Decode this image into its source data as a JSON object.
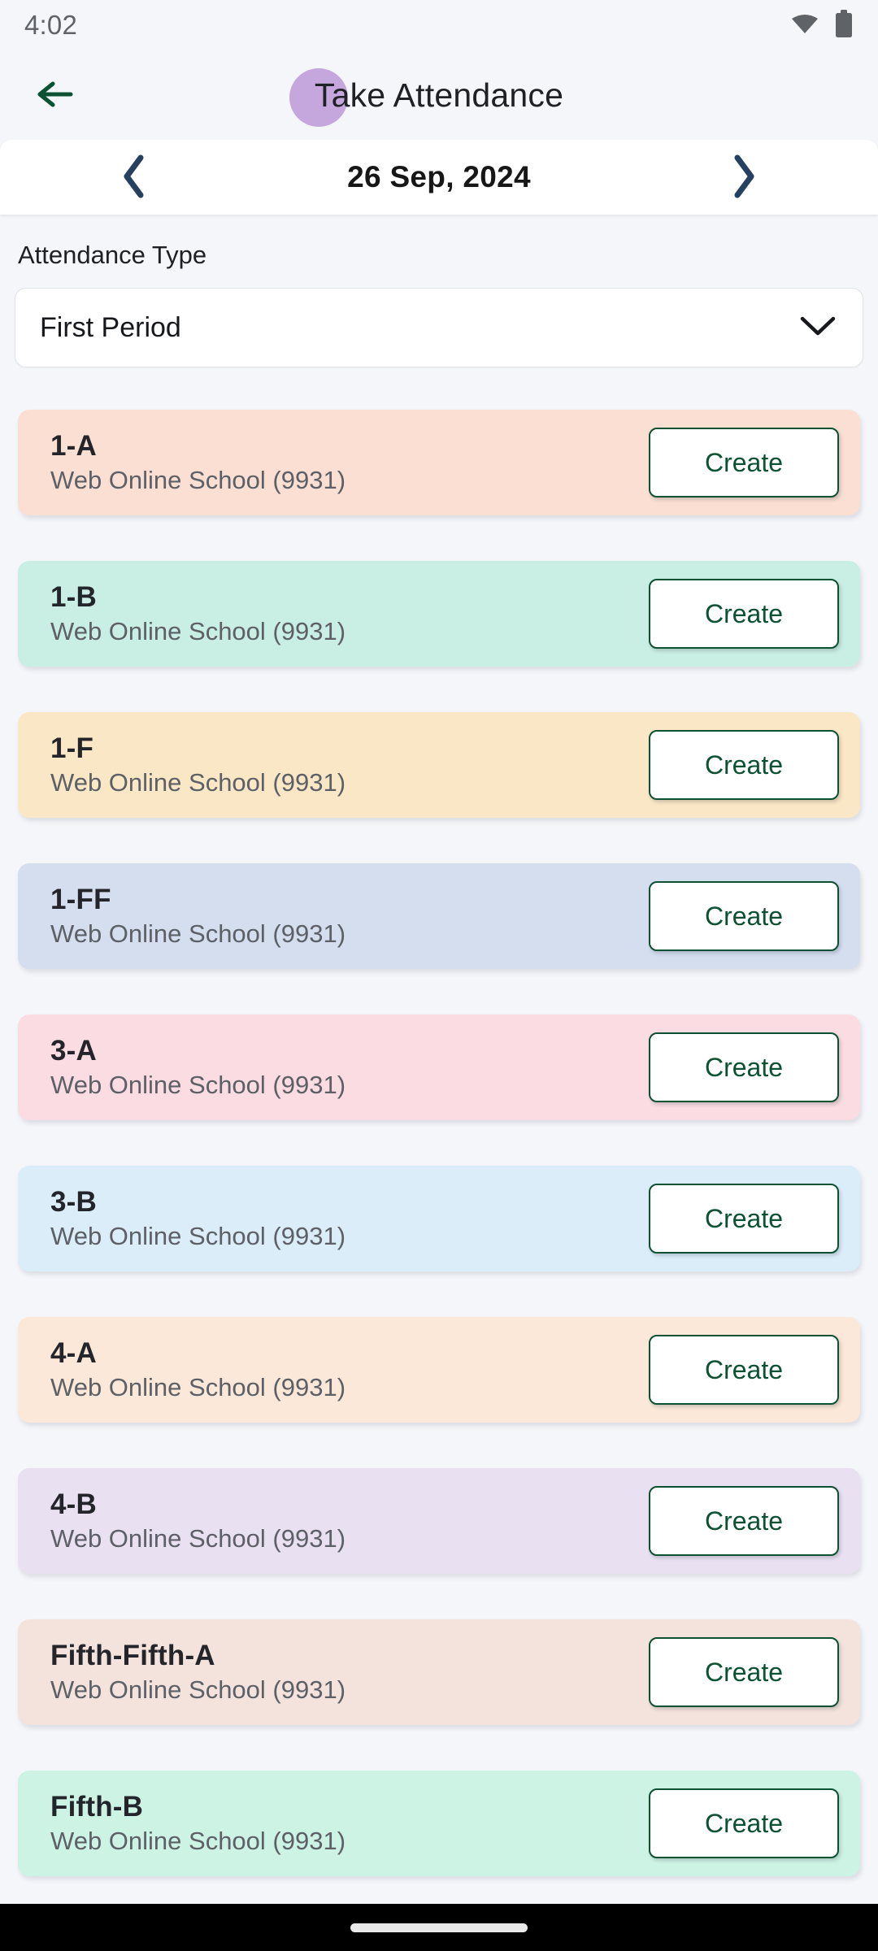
{
  "status_bar": {
    "time": "4:02",
    "wifi_icon": "wifi-icon",
    "battery_icon": "battery-icon"
  },
  "app_bar": {
    "back_icon": "arrow-left-icon",
    "title": "Take Attendance",
    "title_highlight_color": "#C6A7DD",
    "accent_color": "#0B5132"
  },
  "date_bar": {
    "prev_icon": "chevron-left-icon",
    "next_icon": "chevron-right-icon",
    "date": "26 Sep, 2024",
    "chevron_color": "#26415F"
  },
  "attendance_type": {
    "label": "Attendance Type",
    "selected": "First Period",
    "chevron_icon": "chevron-down-icon"
  },
  "classes": [
    {
      "name": "1-A",
      "school": "Web Online School (9931)",
      "action": "Create",
      "color": "#FBDFD3"
    },
    {
      "name": "1-B",
      "school": "Web Online School (9931)",
      "action": "Create",
      "color": "#C9EEE3"
    },
    {
      "name": "1-F",
      "school": "Web Online School (9931)",
      "action": "Create",
      "color": "#FAE7C5"
    },
    {
      "name": "1-FF",
      "school": "Web Online School (9931)",
      "action": "Create",
      "color": "#D4DEEF"
    },
    {
      "name": "3-A",
      "school": "Web Online School (9931)",
      "action": "Create",
      "color": "#FBDCE2"
    },
    {
      "name": "3-B",
      "school": "Web Online School (9931)",
      "action": "Create",
      "color": "#DCEDFA"
    },
    {
      "name": "4-A",
      "school": "Web Online School (9931)",
      "action": "Create",
      "color": "#FBE8D8"
    },
    {
      "name": "4-B",
      "school": "Web Online School (9931)",
      "action": "Create",
      "color": "#E9E1F2"
    },
    {
      "name": "Fifth-Fifth-A",
      "school": "Web Online School (9931)",
      "action": "Create",
      "color": "#F4E3DC"
    },
    {
      "name": "Fifth-B",
      "school": "Web Online School (9931)",
      "action": "Create",
      "color": "#CDF3E4"
    }
  ],
  "nav_bar": {
    "home_indicator": "home-indicator"
  }
}
